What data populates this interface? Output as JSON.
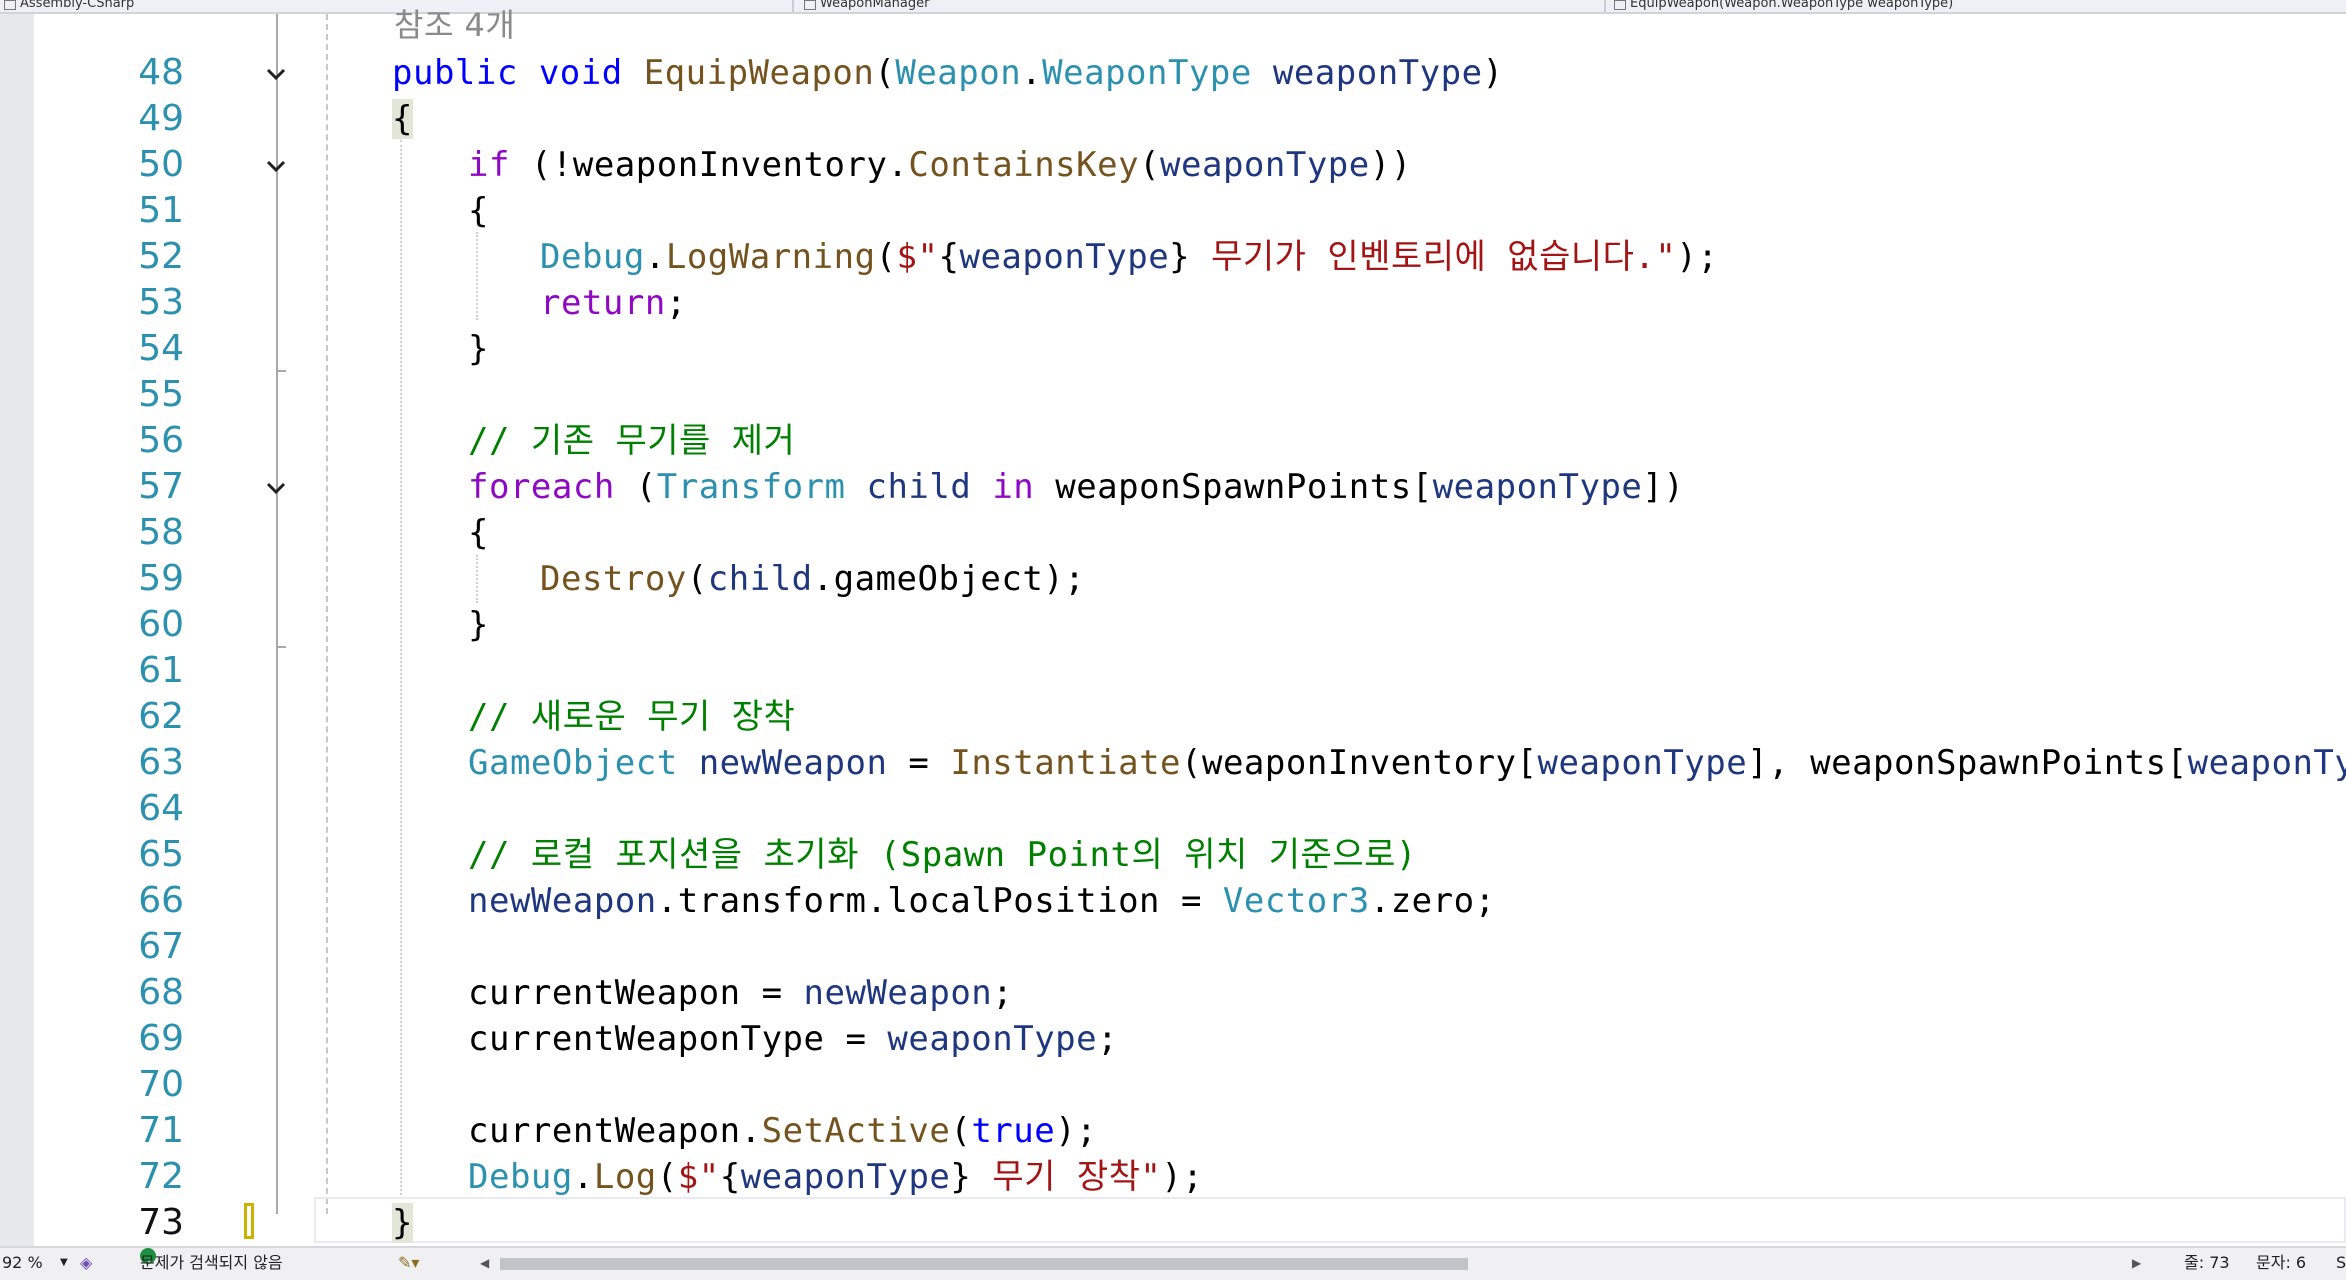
{
  "nav_bar": {
    "project": "Assembly-CSharp",
    "class": "WeaponManager",
    "member": "EquipWeapon(Weapon.WeaponType weaponType)"
  },
  "code_lens": "참조 4개",
  "line_numbers": [
    "48",
    "49",
    "50",
    "51",
    "52",
    "53",
    "54",
    "55",
    "56",
    "57",
    "58",
    "59",
    "60",
    "61",
    "62",
    "63",
    "64",
    "65",
    "66",
    "67",
    "68",
    "69",
    "70",
    "71",
    "72",
    "73"
  ],
  "code": {
    "l48": {
      "kw1": "public",
      "kw2": "void",
      "name": "EquipWeapon",
      "open": "(",
      "ty1": "Weapon",
      "dot": ".",
      "ty2": "WeaponType",
      "param": "weaponType",
      "close": ")"
    },
    "l49": {
      "brace": "{"
    },
    "l50": {
      "kw": "if",
      "p1": " (!weaponInventory.",
      "method": "ContainsKey",
      "p2": "(",
      "param": "weaponType",
      "p3": "))"
    },
    "l51": {
      "brace": "{"
    },
    "l52": {
      "ty": "Debug",
      "dot": ".",
      "method": "LogWarning",
      "p1": "(",
      "s1": "$\"",
      "b1": "{",
      "param": "weaponType",
      "b2": "}",
      "s2": " 무기가 인벤토리에 없습니다.\"",
      "end": ");"
    },
    "l53": {
      "kw": "return",
      "end": ";"
    },
    "l54": {
      "brace": "}"
    },
    "l56": {
      "comment": "// 기존 무기를 제거"
    },
    "l57": {
      "kw": "foreach",
      "p1": " (",
      "ty": "Transform",
      "var": "child",
      "kw2": "in",
      "p2": " weaponSpawnPoints[",
      "param": "weaponType",
      "p3": "])"
    },
    "l58": {
      "brace": "{"
    },
    "l59": {
      "method": "Destroy",
      "p1": "(",
      "var": "child",
      "p2": ".gameObject);"
    },
    "l60": {
      "brace": "}"
    },
    "l62": {
      "comment": "// 새로운 무기 장착"
    },
    "l63": {
      "ty": "GameObject",
      "var": "newWeapon",
      "eq": " = ",
      "method": "Instantiate",
      "p1": "(weaponInventory[",
      "param1": "weaponType",
      "p2": "], weaponSpawnPoints[",
      "param2": "weaponType",
      "p3": "]);"
    },
    "l65": {
      "comment": "// 로컬 포지션을 초기화 (Spawn Point의 위치 기준으로)"
    },
    "l66": {
      "var": "newWeapon",
      "p1": ".transform.localPosition = ",
      "ty": "Vector3",
      "p2": ".zero;"
    },
    "l68": {
      "fld": "currentWeapon",
      "eq": " = ",
      "var": "newWeapon",
      "end": ";"
    },
    "l69": {
      "fld": "currentWeaponType",
      "eq": " = ",
      "param": "weaponType",
      "end": ";"
    },
    "l71": {
      "fld": "currentWeapon",
      "dot": ".",
      "method": "SetActive",
      "p1": "(",
      "kw": "true",
      "end": ");"
    },
    "l72": {
      "ty": "Debug",
      "dot": ".",
      "method": "Log",
      "p1": "(",
      "s1": "$\"",
      "b1": "{",
      "param": "weaponType",
      "b2": "}",
      "s2": " 무기 장착\"",
      "end": ");"
    },
    "l73": {
      "brace": "}"
    }
  },
  "status_bar": {
    "zoom": "92 %",
    "issues": "문제가 검색되지 않음",
    "line": "줄: 73",
    "col": "문자: 6",
    "extra": "S"
  }
}
